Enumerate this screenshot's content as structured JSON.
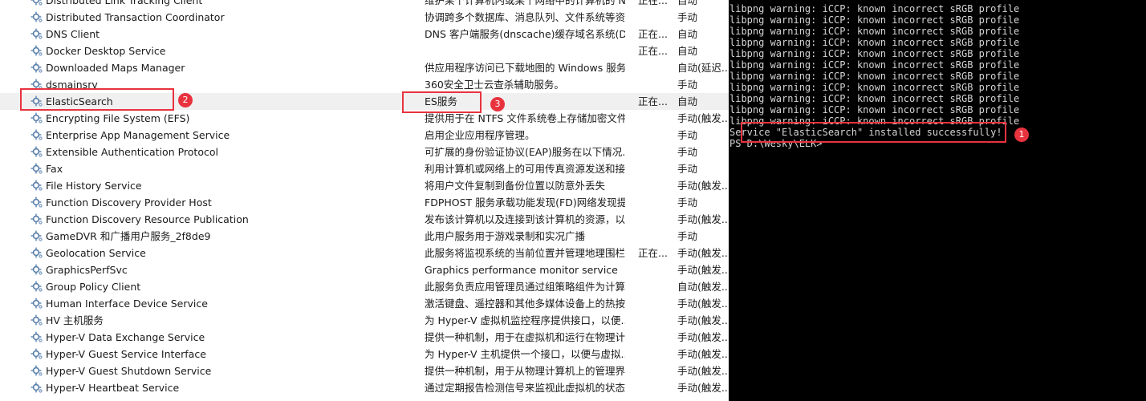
{
  "services": [
    {
      "name": "Distributed Link Tracking Client",
      "desc": "维护某个计算机内或某个网络中的计算机的 N...",
      "status": "正在...",
      "start": "自动"
    },
    {
      "name": "Distributed Transaction Coordinator",
      "desc": "协调跨多个数据库、消息队列、文件系统等资...",
      "status": "",
      "start": "手动"
    },
    {
      "name": "DNS Client",
      "desc": "DNS 客户端服务(dnscache)缓存域名系统(D...",
      "status": "正在...",
      "start": "自动"
    },
    {
      "name": "Docker Desktop Service",
      "desc": "",
      "status": "正在...",
      "start": "自动"
    },
    {
      "name": "Downloaded Maps Manager",
      "desc": "供应用程序访问已下载地图的 Windows 服务...",
      "status": "",
      "start": "自动(延迟..."
    },
    {
      "name": "dsmainsrv",
      "desc": "360安全卫士云查杀辅助服务。",
      "status": "",
      "start": "手动"
    },
    {
      "name": "ElasticSearch",
      "desc": "ES服务",
      "status": "正在...",
      "start": "自动",
      "selected": true
    },
    {
      "name": "Encrypting File System (EFS)",
      "desc": "提供用于在 NTFS 文件系统卷上存储加密文件...",
      "status": "",
      "start": "手动(触发..."
    },
    {
      "name": "Enterprise App Management Service",
      "desc": "启用企业应用程序管理。",
      "status": "",
      "start": "手动"
    },
    {
      "name": "Extensible Authentication Protocol",
      "desc": "可扩展的身份验证协议(EAP)服务在以下情况...",
      "status": "",
      "start": "手动"
    },
    {
      "name": "Fax",
      "desc": "利用计算机或网络上的可用传真资源发送和接...",
      "status": "",
      "start": "手动"
    },
    {
      "name": "File History Service",
      "desc": "将用户文件复制到备份位置以防意外丢失",
      "status": "",
      "start": "手动(触发..."
    },
    {
      "name": "Function Discovery Provider Host",
      "desc": "FDPHOST 服务承载功能发现(FD)网络发现提...",
      "status": "",
      "start": "手动"
    },
    {
      "name": "Function Discovery Resource Publication",
      "desc": "发布该计算机以及连接到该计算机的资源，以...",
      "status": "",
      "start": "手动(触发..."
    },
    {
      "name": "GameDVR 和广播用户服务_2f8de9",
      "desc": "此用户服务用于游戏录制和实况广播",
      "status": "",
      "start": "手动"
    },
    {
      "name": "Geolocation Service",
      "desc": "此服务将监视系统的当前位置并管理地理围栏(...",
      "status": "正在...",
      "start": "手动(触发..."
    },
    {
      "name": "GraphicsPerfSvc",
      "desc": "Graphics performance monitor service",
      "status": "",
      "start": "手动(触发..."
    },
    {
      "name": "Group Policy Client",
      "desc": "此服务负责应用管理员通过组策略组件为计算...",
      "status": "",
      "start": "自动(触发..."
    },
    {
      "name": "Human Interface Device Service",
      "desc": "激活键盘、遥控器和其他多媒体设备上的热按...",
      "status": "",
      "start": "手动(触发..."
    },
    {
      "name": "HV 主机服务",
      "desc": "为 Hyper-V 虚拟机监控程序提供接口，以便...",
      "status": "",
      "start": "手动(触发..."
    },
    {
      "name": "Hyper-V Data Exchange Service",
      "desc": "提供一种机制，用于在虚拟机和运行在物理计...",
      "status": "",
      "start": "手动(触发..."
    },
    {
      "name": "Hyper-V Guest Service Interface",
      "desc": "为 Hyper-V 主机提供一个接口，以便与虚拟...",
      "status": "",
      "start": "手动(触发..."
    },
    {
      "name": "Hyper-V Guest Shutdown Service",
      "desc": "提供一种机制，用于从物理计算机上的管理界...",
      "status": "",
      "start": "手动(触发..."
    },
    {
      "name": "Hyper-V Heartbeat Service",
      "desc": "通过定期报告检测信号来监视此虚拟机的状态...",
      "status": "",
      "start": "手动(触发..."
    }
  ],
  "annotations": {
    "n1": "1",
    "n2": "2",
    "n3": "3"
  },
  "terminal": {
    "lines": [
      "libpng warning: iCCP: known incorrect sRGB profile",
      "libpng warning: iCCP: known incorrect sRGB profile",
      "libpng warning: iCCP: known incorrect sRGB profile",
      "libpng warning: iCCP: known incorrect sRGB profile",
      "libpng warning: iCCP: known incorrect sRGB profile",
      "libpng warning: iCCP: known incorrect sRGB profile",
      "libpng warning: iCCP: known incorrect sRGB profile",
      "libpng warning: iCCP: known incorrect sRGB profile",
      "libpng warning: iCCP: known incorrect sRGB profile",
      "libpng warning: iCCP: known incorrect sRGB profile",
      "libpng warning: iCCP: known incorrect sRGB profile",
      "Service \"ElasticSearch\" installed successfully!",
      "PS D:\\Wesky\\ELK>"
    ]
  },
  "colors": {
    "annotation": "#e8333f",
    "terminal_bg": "#000000",
    "terminal_fg": "#d4d4d4",
    "selected_row": "#f0f0f0"
  }
}
